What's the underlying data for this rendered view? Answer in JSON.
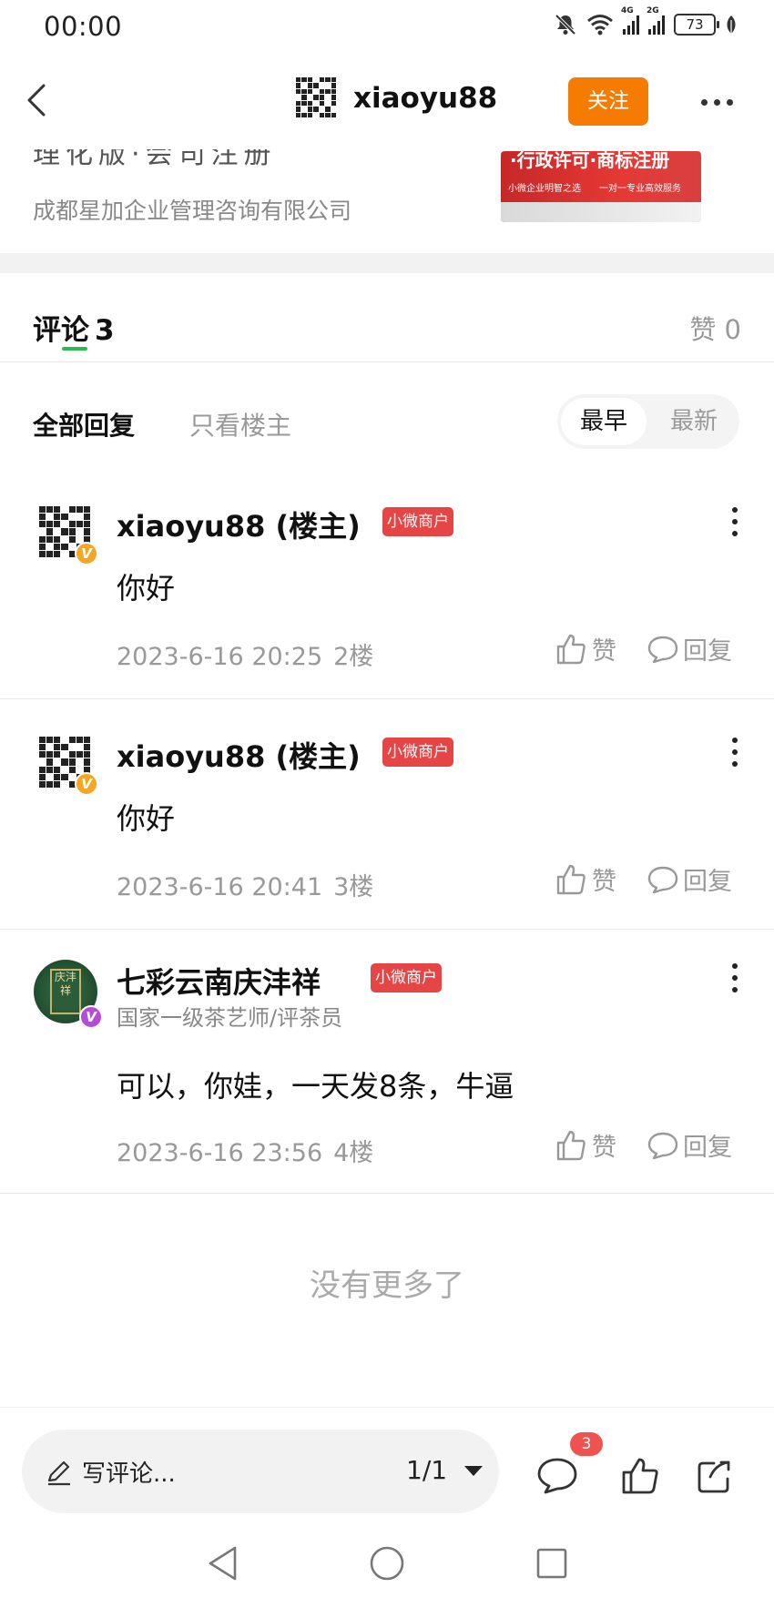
{
  "status_bar": {
    "time": "00:00",
    "signal1_label": "4G",
    "signal2_label": "2G",
    "battery": "73"
  },
  "header": {
    "username": "xiaoyu88",
    "follow_label": "关注"
  },
  "ad": {
    "cut_text": "理化版·会司注册",
    "company": "成都星加企业管理咨询有限公司",
    "image_line1": "·行政许可·商标注册",
    "image_line2": "小微企业明智之选　　一对一专业高效服务"
  },
  "tabs": {
    "comments_label": "评论",
    "comments_count": "3",
    "likes_label": "赞 0"
  },
  "filter": {
    "all_label": "全部回复",
    "op_only_label": "只看楼主",
    "sort_earliest": "最早",
    "sort_latest": "最新"
  },
  "comments": [
    {
      "name": "xiaoyu88 (楼主)",
      "tag": "小微商户",
      "avatar_badge": "V",
      "text": "你好",
      "time": "2023-6-16 20:25",
      "floor": "2楼",
      "like_label": "赞",
      "reply_label": "回复"
    },
    {
      "name": "xiaoyu88 (楼主)",
      "tag": "小微商户",
      "avatar_badge": "V",
      "text": "你好",
      "time": "2023-6-16 20:41",
      "floor": "3楼",
      "like_label": "赞",
      "reply_label": "回复"
    },
    {
      "name": "七彩云南庆沣祥",
      "tag": "小微商户",
      "avatar_text": "庆沣祥",
      "avatar_badge": "V",
      "subtitle": "国家一级茶艺师/评茶员",
      "text": "可以，你娃，一天发8条，牛逼",
      "time": "2023-6-16 23:56",
      "floor": "4楼",
      "like_label": "赞",
      "reply_label": "回复"
    }
  ],
  "end_text": "没有更多了",
  "bottom_bar": {
    "write_placeholder": "写评论...",
    "page_indicator": "1/1",
    "comment_badge": "3"
  },
  "colors": {
    "follow_orange": "#f57c00",
    "tag_red": "#e64545",
    "tab_green": "#2fb84e",
    "badge_gold": "#f5a623",
    "badge_purple": "#b34dd9",
    "notif_red": "#ef5350"
  },
  "icons": [
    "back-arrow-icon",
    "more-dots-icon",
    "mute-bell-icon",
    "wifi-icon",
    "signal-icon",
    "battery-icon",
    "leaf-icon",
    "kebab-icon",
    "thumb-up-icon",
    "reply-bubble-icon",
    "pen-icon",
    "caret-down-icon",
    "comment-icon",
    "like-icon",
    "share-icon",
    "nav-back-icon",
    "nav-home-icon",
    "nav-recents-icon"
  ]
}
